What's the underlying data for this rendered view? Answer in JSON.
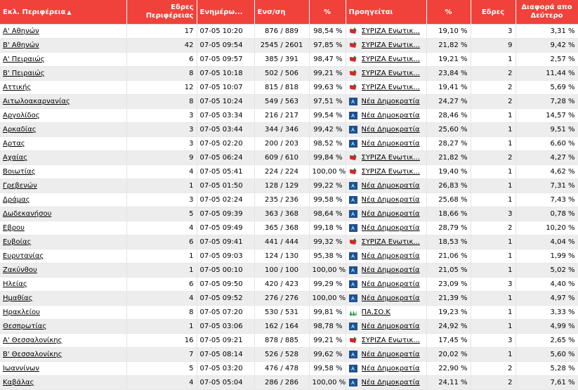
{
  "headers": {
    "region": "Εκλ. Περιφέρεια",
    "seats_region": "Εδρες Περιφέρειας",
    "updated": "Ενημέρω...",
    "counted": "Ενσ/ση",
    "pct": "%",
    "leading": "Προηγείται",
    "party_pct": "%",
    "seats": "Εδρες",
    "diff": "Διαφορά απο Δεύτερο"
  },
  "icons": {
    "sort": "sort-ascending-icon",
    "syriza": "syriza-logo-icon",
    "nd": "nd-logo-icon",
    "pasok": "pasok-logo-icon"
  },
  "colors": {
    "header_bg": "#f0423a",
    "row_alt": "#ededed"
  },
  "rows": [
    {
      "region": "Α' Αθηνών",
      "seats_region": "17",
      "updated": "07-05 10:20",
      "counted": "876 / 889",
      "pct": "98,54 %",
      "party": "syriza",
      "leading": "ΣΥΡΙΖΑ Ενωτικ...",
      "party_pct": "19,10 %",
      "seats": "3",
      "diff": "3,31 %"
    },
    {
      "region": "Β' Αθηνών",
      "seats_region": "42",
      "updated": "07-05 09:54",
      "counted": "2545 / 2601",
      "pct": "97,85 %",
      "party": "syriza",
      "leading": "ΣΥΡΙΖΑ Ενωτικ...",
      "party_pct": "21,82 %",
      "seats": "9",
      "diff": "9,42 %"
    },
    {
      "region": "Α' Πειραιώς",
      "seats_region": "6",
      "updated": "07-05 09:57",
      "counted": "385 / 391",
      "pct": "98,47 %",
      "party": "syriza",
      "leading": "ΣΥΡΙΖΑ Ενωτικ...",
      "party_pct": "19,21 %",
      "seats": "1",
      "diff": "2,57 %"
    },
    {
      "region": "Β' Πειραιώς",
      "seats_region": "8",
      "updated": "07-05 10:18",
      "counted": "502 / 506",
      "pct": "99,21 %",
      "party": "syriza",
      "leading": "ΣΥΡΙΖΑ Ενωτικ...",
      "party_pct": "23,84 %",
      "seats": "2",
      "diff": "11,44 %"
    },
    {
      "region": "Αττικής",
      "seats_region": "12",
      "updated": "07-05 10:07",
      "counted": "815 / 818",
      "pct": "99,63 %",
      "party": "syriza",
      "leading": "ΣΥΡΙΖΑ Ενωτικ...",
      "party_pct": "19,41 %",
      "seats": "2",
      "diff": "5,69 %"
    },
    {
      "region": "Αιτωλοακαρνανίας",
      "seats_region": "8",
      "updated": "07-05 10:24",
      "counted": "549 / 563",
      "pct": "97,51 %",
      "party": "nd",
      "leading": "Νέα Δημοκρατία",
      "party_pct": "24,27 %",
      "seats": "2",
      "diff": "7,28 %"
    },
    {
      "region": "Αργολίδος",
      "seats_region": "3",
      "updated": "07-05 03:34",
      "counted": "216 / 217",
      "pct": "99,54 %",
      "party": "nd",
      "leading": "Νέα Δημοκρατία",
      "party_pct": "28,46 %",
      "seats": "1",
      "diff": "14,57 %"
    },
    {
      "region": "Αρκαδίας",
      "seats_region": "3",
      "updated": "07-05 03:44",
      "counted": "344 / 346",
      "pct": "99,42 %",
      "party": "nd",
      "leading": "Νέα Δημοκρατία",
      "party_pct": "25,60 %",
      "seats": "1",
      "diff": "9,51 %"
    },
    {
      "region": "Αρτας",
      "seats_region": "3",
      "updated": "07-05 02:20",
      "counted": "200 / 203",
      "pct": "98,52 %",
      "party": "nd",
      "leading": "Νέα Δημοκρατία",
      "party_pct": "28,27 %",
      "seats": "1",
      "diff": "6,60 %"
    },
    {
      "region": "Αχαίας",
      "seats_region": "9",
      "updated": "07-05 06:24",
      "counted": "609 / 610",
      "pct": "99,84 %",
      "party": "syriza",
      "leading": "ΣΥΡΙΖΑ Ενωτικ...",
      "party_pct": "21,82 %",
      "seats": "2",
      "diff": "4,27 %"
    },
    {
      "region": "Βοιωτίας",
      "seats_region": "4",
      "updated": "07-05 05:41",
      "counted": "224 / 224",
      "pct": "100,00 %",
      "party": "syriza",
      "leading": "ΣΥΡΙΖΑ Ενωτικ...",
      "party_pct": "19,40 %",
      "seats": "1",
      "diff": "4,62 %"
    },
    {
      "region": "Γρεβενών",
      "seats_region": "1",
      "updated": "07-05 01:50",
      "counted": "128 / 129",
      "pct": "99,22 %",
      "party": "nd",
      "leading": "Νέα Δημοκρατία",
      "party_pct": "26,83 %",
      "seats": "1",
      "diff": "7,31 %"
    },
    {
      "region": "Δράμας",
      "seats_region": "3",
      "updated": "07-05 02:24",
      "counted": "235 / 236",
      "pct": "99,58 %",
      "party": "nd",
      "leading": "Νέα Δημοκρατία",
      "party_pct": "25,68 %",
      "seats": "1",
      "diff": "7,43 %"
    },
    {
      "region": "Δωδεκανήσου",
      "seats_region": "5",
      "updated": "07-05 09:39",
      "counted": "363 / 368",
      "pct": "98,64 %",
      "party": "nd",
      "leading": "Νέα Δημοκρατία",
      "party_pct": "18,66 %",
      "seats": "3",
      "diff": "0,78 %"
    },
    {
      "region": "Εβρου",
      "seats_region": "4",
      "updated": "07-05 09:49",
      "counted": "365 / 368",
      "pct": "99,18 %",
      "party": "nd",
      "leading": "Νέα Δημοκρατία",
      "party_pct": "28,79 %",
      "seats": "2",
      "diff": "10,20 %"
    },
    {
      "region": "Ευβοίας",
      "seats_region": "6",
      "updated": "07-05 09:41",
      "counted": "441 / 444",
      "pct": "99,32 %",
      "party": "syriza",
      "leading": "ΣΥΡΙΖΑ Ενωτικ...",
      "party_pct": "18,53 %",
      "seats": "1",
      "diff": "4,04 %"
    },
    {
      "region": "Ευρυτανίας",
      "seats_region": "1",
      "updated": "07-05 09:03",
      "counted": "124 / 130",
      "pct": "95,38 %",
      "party": "nd",
      "leading": "Νέα Δημοκρατία",
      "party_pct": "21,06 %",
      "seats": "1",
      "diff": "1,99 %"
    },
    {
      "region": "Ζακύνθου",
      "seats_region": "1",
      "updated": "07-05 00:10",
      "counted": "100 / 100",
      "pct": "100,00 %",
      "party": "nd",
      "leading": "Νέα Δημοκρατία",
      "party_pct": "21,05 %",
      "seats": "1",
      "diff": "5,02 %"
    },
    {
      "region": "Ηλείας",
      "seats_region": "6",
      "updated": "07-05 09:50",
      "counted": "420 / 423",
      "pct": "99,29 %",
      "party": "nd",
      "leading": "Νέα Δημοκρατία",
      "party_pct": "23,09 %",
      "seats": "3",
      "diff": "4,40 %"
    },
    {
      "region": "Ημαθίας",
      "seats_region": "4",
      "updated": "07-05 09:52",
      "counted": "276 / 276",
      "pct": "100,00 %",
      "party": "nd",
      "leading": "Νέα Δημοκρατία",
      "party_pct": "21,39 %",
      "seats": "1",
      "diff": "4,97 %"
    },
    {
      "region": "Ηρακλείου",
      "seats_region": "8",
      "updated": "07-05 07:20",
      "counted": "530 / 531",
      "pct": "99,81 %",
      "party": "pasok",
      "leading": "ΠΑ.ΣΟ.Κ",
      "party_pct": "19,23 %",
      "seats": "1",
      "diff": "3,33 %"
    },
    {
      "region": "Θεσπρωτίας",
      "seats_region": "1",
      "updated": "07-05 03:06",
      "counted": "162 / 164",
      "pct": "98,78 %",
      "party": "nd",
      "leading": "Νέα Δημοκρατία",
      "party_pct": "24,92 %",
      "seats": "1",
      "diff": "4,99 %"
    },
    {
      "region": "Α' Θεσσαλονίκης",
      "seats_region": "16",
      "updated": "07-05 09:21",
      "counted": "878 / 885",
      "pct": "99,21 %",
      "party": "syriza",
      "leading": "ΣΥΡΙΖΑ Ενωτικ...",
      "party_pct": "17,45 %",
      "seats": "3",
      "diff": "2,65 %"
    },
    {
      "region": "Β' Θεσσαλονίκης",
      "seats_region": "7",
      "updated": "07-05 08:14",
      "counted": "526 / 528",
      "pct": "99,62 %",
      "party": "nd",
      "leading": "Νέα Δημοκρατία",
      "party_pct": "20,02 %",
      "seats": "1",
      "diff": "5,60 %"
    },
    {
      "region": "Ιωαννίνων",
      "seats_region": "5",
      "updated": "07-05 03:20",
      "counted": "476 / 478",
      "pct": "99,58 %",
      "party": "nd",
      "leading": "Νέα Δημοκρατία",
      "party_pct": "22,90 %",
      "seats": "2",
      "diff": "5,28 %"
    },
    {
      "region": "Καβάλας",
      "seats_region": "4",
      "updated": "07-05 05:04",
      "counted": "286 / 286",
      "pct": "100,00 %",
      "party": "nd",
      "leading": "Νέα Δημοκρατία",
      "party_pct": "24,11 %",
      "seats": "2",
      "diff": "7,61 %"
    }
  ]
}
